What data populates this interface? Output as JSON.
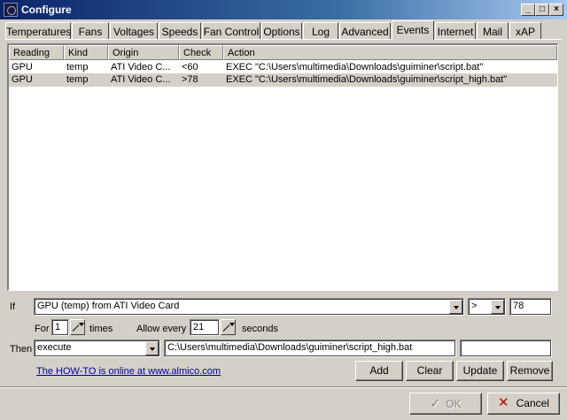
{
  "window": {
    "title": "Configure"
  },
  "tabs": [
    {
      "label": "Temperatures"
    },
    {
      "label": "Fans"
    },
    {
      "label": "Voltages"
    },
    {
      "label": "Speeds"
    },
    {
      "label": "Fan Control"
    },
    {
      "label": "Options"
    },
    {
      "label": "Log"
    },
    {
      "label": "Advanced"
    },
    {
      "label": "Events",
      "active": true
    },
    {
      "label": "Internet"
    },
    {
      "label": "Mail"
    },
    {
      "label": "xAP"
    }
  ],
  "events_list": {
    "columns": [
      "Reading",
      "Kind",
      "Origin",
      "Check",
      "Action"
    ],
    "rows": [
      [
        "GPU",
        "temp",
        "ATI Video C...",
        "<60",
        "EXEC \"C:\\Users\\multimedia\\Downloads\\guiminer\\script.bat\""
      ],
      [
        "GPU",
        "temp",
        "ATI Video C...",
        ">78",
        "EXEC \"C:\\Users\\multimedia\\Downloads\\guiminer\\script_high.bat\""
      ]
    ],
    "selected_row": 1
  },
  "form": {
    "if_label": "If",
    "sensor_value": "GPU (temp) from ATI Video Card",
    "operator_value": ">",
    "threshold_value": "78",
    "for_label": "For",
    "for_value": "1",
    "times_label": "times",
    "allow_every_label": "Allow every",
    "allow_every_value": "21",
    "seconds_label": "seconds",
    "then_label": "Then",
    "action_value": "execute",
    "path_value": "C:\\Users\\multimedia\\Downloads\\guiminer\\script_high.bat",
    "extra_value": "",
    "howto_link": "The HOW-TO is online at www.almico.com"
  },
  "buttons": {
    "add": "Add",
    "clear": "Clear",
    "update": "Update",
    "remove": "Remove",
    "ok": "OK",
    "cancel": "Cancel"
  }
}
